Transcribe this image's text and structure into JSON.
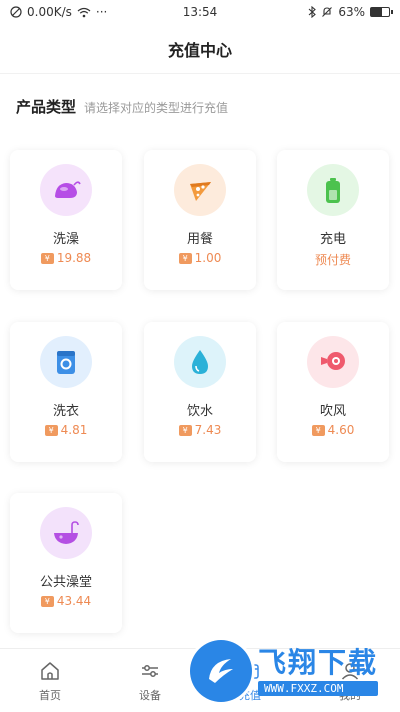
{
  "status_bar": {
    "network_speed": "0.00K/s",
    "more": "···",
    "time": "13:54",
    "battery": "63%",
    "battery_level": 0.63
  },
  "navbar": {
    "title": "充值中心"
  },
  "section": {
    "title": "产品类型",
    "subtitle": "请选择对应的类型进行充值"
  },
  "products": [
    {
      "name": "洗澡",
      "price": "19.88",
      "show_yen": true,
      "icon": "shower-bag-icon",
      "icon_bg": "#f5e3fb",
      "icon_color": "#b64ee6"
    },
    {
      "name": "用餐",
      "price": "1.00",
      "show_yen": true,
      "icon": "pizza-icon",
      "icon_bg": "#fdebdc",
      "icon_color": "#f39a3d"
    },
    {
      "name": "充电",
      "price": "预付费",
      "show_yen": false,
      "icon": "battery-icon",
      "icon_bg": "#e4f7e4",
      "icon_color": "#4cc24e"
    },
    {
      "name": "洗衣",
      "price": "4.81",
      "show_yen": true,
      "icon": "washing-machine-icon",
      "icon_bg": "#e2effd",
      "icon_color": "#3d8fe6"
    },
    {
      "name": "饮水",
      "price": "7.43",
      "show_yen": true,
      "icon": "water-drop-icon",
      "icon_bg": "#ddf3fa",
      "icon_color": "#2bb1d8"
    },
    {
      "name": "吹风",
      "price": "4.60",
      "show_yen": true,
      "icon": "hair-dryer-icon",
      "icon_bg": "#fde6e9",
      "icon_color": "#ef5a6d"
    },
    {
      "name": "公共澡堂",
      "price": "43.44",
      "show_yen": true,
      "icon": "bathtub-icon",
      "icon_bg": "#f3e2fb",
      "icon_color": "#b44fe3"
    }
  ],
  "currency_symbol": "¥",
  "tabbar": [
    {
      "label": "首页",
      "icon": "home-icon",
      "active": false
    },
    {
      "label": "设备",
      "icon": "sliders-icon",
      "active": false
    },
    {
      "label": "充值",
      "icon": "recharge-icon",
      "active": true
    },
    {
      "label": "我的",
      "icon": "user-icon",
      "active": false
    }
  ],
  "watermark": {
    "title": "飞翔下载",
    "url": "WWW.FXXZ.COM"
  },
  "colors": {
    "accent": "#3c8ce7",
    "price": "#ee8a53"
  }
}
